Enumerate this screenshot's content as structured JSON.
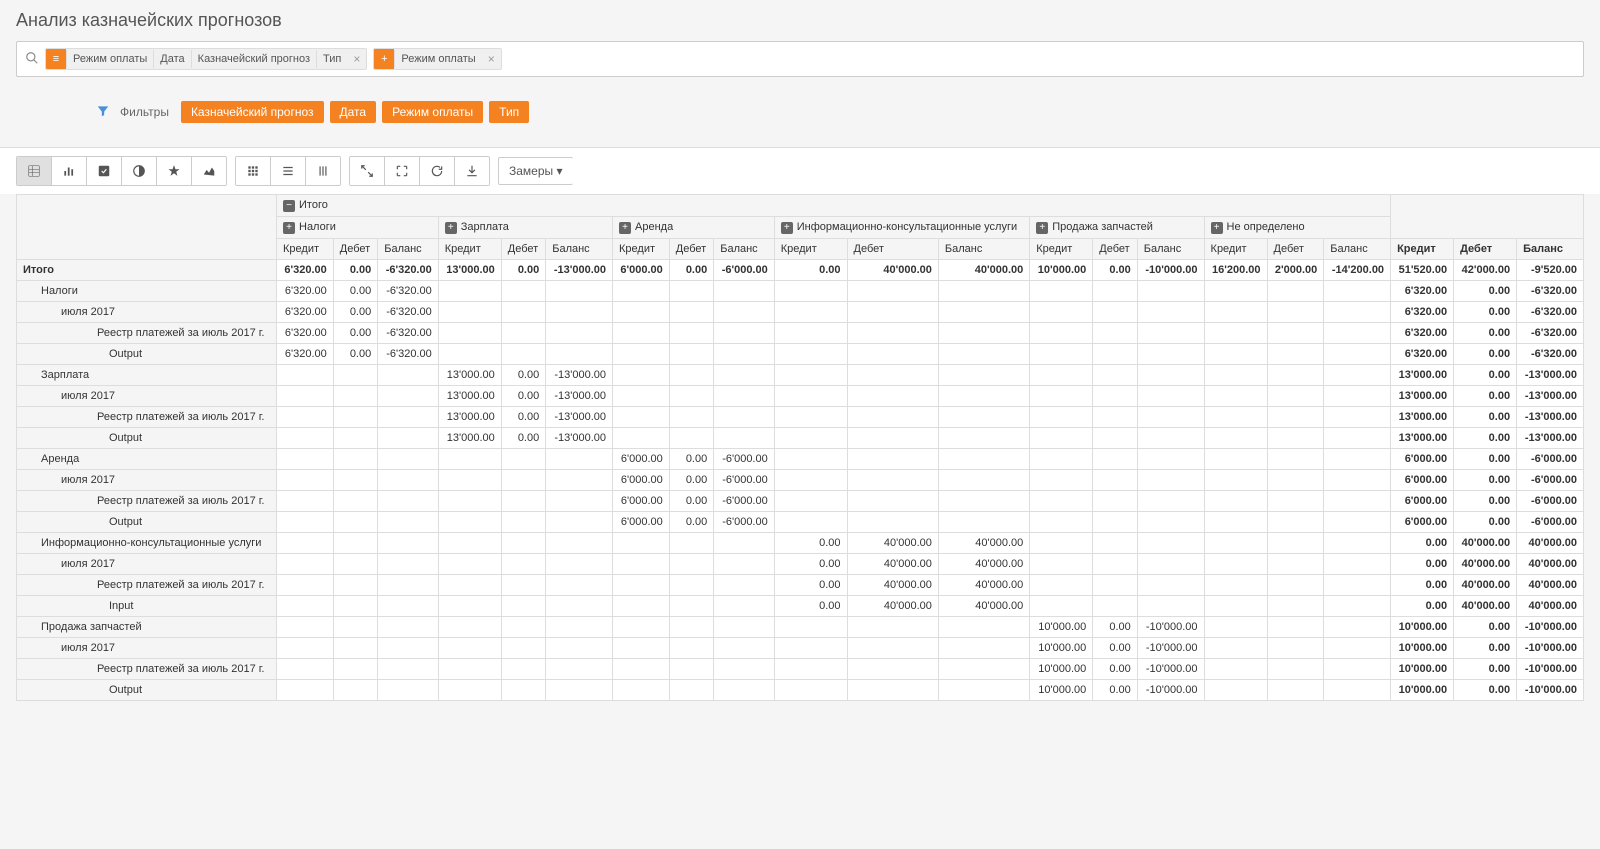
{
  "page_title": "Анализ казначейских прогнозов",
  "search": {
    "tag1_parts": [
      "Режим оплаты",
      "Дата",
      "Казначейский прогноз",
      "Тип"
    ],
    "tag2_parts": [
      "Режим оплаты"
    ]
  },
  "filters": {
    "label": "Фильтры",
    "chips": [
      "Казначейский прогноз",
      "Дата",
      "Режим оплаты",
      "Тип"
    ]
  },
  "toolbar": {
    "measures": "Замеры"
  },
  "table": {
    "total_label": "Итого",
    "col_groups": [
      "Налоги",
      "Зарплата",
      "Аренда",
      "Информационно-консультационные услуги",
      "Продажа запчастей",
      "Не определено"
    ],
    "sub_cols": [
      "Кредит",
      "Дебет",
      "Баланс"
    ],
    "rows": [
      {
        "label": "Итого",
        "indent": 0,
        "bold": true,
        "nalogi": [
          "6'320.00",
          "0.00",
          "-6'320.00"
        ],
        "zarplata": [
          "13'000.00",
          "0.00",
          "-13'000.00"
        ],
        "arenda": [
          "6'000.00",
          "0.00",
          "-6'000.00"
        ],
        "info": [
          "0.00",
          "40'000.00",
          "40'000.00"
        ],
        "prodazha": [
          "10'000.00",
          "0.00",
          "-10'000.00"
        ],
        "neopr": [
          "16'200.00",
          "2'000.00",
          "-14'200.00"
        ],
        "total": [
          "51'520.00",
          "42'000.00",
          "-9'520.00"
        ]
      },
      {
        "label": "Налоги",
        "indent": 1,
        "nalogi": [
          "6'320.00",
          "0.00",
          "-6'320.00"
        ],
        "total": [
          "6'320.00",
          "0.00",
          "-6'320.00"
        ]
      },
      {
        "label": "июля 2017",
        "indent": 2,
        "nalogi": [
          "6'320.00",
          "0.00",
          "-6'320.00"
        ],
        "total": [
          "6'320.00",
          "0.00",
          "-6'320.00"
        ]
      },
      {
        "label": "Реестр платежей за июль 2017 г.",
        "indent": 3,
        "nalogi": [
          "6'320.00",
          "0.00",
          "-6'320.00"
        ],
        "total": [
          "6'320.00",
          "0.00",
          "-6'320.00"
        ]
      },
      {
        "label": "Output",
        "indent": 4,
        "nalogi": [
          "6'320.00",
          "0.00",
          "-6'320.00"
        ],
        "total": [
          "6'320.00",
          "0.00",
          "-6'320.00"
        ]
      },
      {
        "label": "Зарплата",
        "indent": 1,
        "zarplata": [
          "13'000.00",
          "0.00",
          "-13'000.00"
        ],
        "total": [
          "13'000.00",
          "0.00",
          "-13'000.00"
        ]
      },
      {
        "label": "июля 2017",
        "indent": 2,
        "zarplata": [
          "13'000.00",
          "0.00",
          "-13'000.00"
        ],
        "total": [
          "13'000.00",
          "0.00",
          "-13'000.00"
        ]
      },
      {
        "label": "Реестр платежей за июль 2017 г.",
        "indent": 3,
        "zarplata": [
          "13'000.00",
          "0.00",
          "-13'000.00"
        ],
        "total": [
          "13'000.00",
          "0.00",
          "-13'000.00"
        ]
      },
      {
        "label": "Output",
        "indent": 4,
        "zarplata": [
          "13'000.00",
          "0.00",
          "-13'000.00"
        ],
        "total": [
          "13'000.00",
          "0.00",
          "-13'000.00"
        ]
      },
      {
        "label": "Аренда",
        "indent": 1,
        "arenda": [
          "6'000.00",
          "0.00",
          "-6'000.00"
        ],
        "total": [
          "6'000.00",
          "0.00",
          "-6'000.00"
        ]
      },
      {
        "label": "июля 2017",
        "indent": 2,
        "arenda": [
          "6'000.00",
          "0.00",
          "-6'000.00"
        ],
        "total": [
          "6'000.00",
          "0.00",
          "-6'000.00"
        ]
      },
      {
        "label": "Реестр платежей за июль 2017 г.",
        "indent": 3,
        "arenda": [
          "6'000.00",
          "0.00",
          "-6'000.00"
        ],
        "total": [
          "6'000.00",
          "0.00",
          "-6'000.00"
        ]
      },
      {
        "label": "Output",
        "indent": 4,
        "arenda": [
          "6'000.00",
          "0.00",
          "-6'000.00"
        ],
        "total": [
          "6'000.00",
          "0.00",
          "-6'000.00"
        ]
      },
      {
        "label": "Информационно-консультационные услуги",
        "indent": 1,
        "info": [
          "0.00",
          "40'000.00",
          "40'000.00"
        ],
        "total": [
          "0.00",
          "40'000.00",
          "40'000.00"
        ]
      },
      {
        "label": "июля 2017",
        "indent": 2,
        "info": [
          "0.00",
          "40'000.00",
          "40'000.00"
        ],
        "total": [
          "0.00",
          "40'000.00",
          "40'000.00"
        ]
      },
      {
        "label": "Реестр платежей за июль 2017 г.",
        "indent": 3,
        "info": [
          "0.00",
          "40'000.00",
          "40'000.00"
        ],
        "total": [
          "0.00",
          "40'000.00",
          "40'000.00"
        ]
      },
      {
        "label": "Input",
        "indent": 4,
        "info": [
          "0.00",
          "40'000.00",
          "40'000.00"
        ],
        "total": [
          "0.00",
          "40'000.00",
          "40'000.00"
        ]
      },
      {
        "label": "Продажа запчастей",
        "indent": 1,
        "prodazha": [
          "10'000.00",
          "0.00",
          "-10'000.00"
        ],
        "total": [
          "10'000.00",
          "0.00",
          "-10'000.00"
        ]
      },
      {
        "label": "июля 2017",
        "indent": 2,
        "prodazha": [
          "10'000.00",
          "0.00",
          "-10'000.00"
        ],
        "total": [
          "10'000.00",
          "0.00",
          "-10'000.00"
        ]
      },
      {
        "label": "Реестр платежей за июль 2017 г.",
        "indent": 3,
        "prodazha": [
          "10'000.00",
          "0.00",
          "-10'000.00"
        ],
        "total": [
          "10'000.00",
          "0.00",
          "-10'000.00"
        ]
      },
      {
        "label": "Output",
        "indent": 4,
        "prodazha": [
          "10'000.00",
          "0.00",
          "-10'000.00"
        ],
        "total": [
          "10'000.00",
          "0.00",
          "-10'000.00"
        ]
      }
    ]
  }
}
